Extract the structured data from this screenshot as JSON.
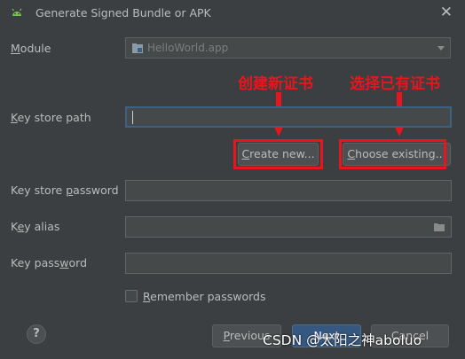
{
  "window": {
    "title": "Generate Signed Bundle or APK",
    "close_glyph": "✕"
  },
  "icons": {
    "app": "android-icon",
    "module": "module-folder-icon",
    "browse": "folder-icon",
    "help": "help-icon"
  },
  "module": {
    "label_u": "M",
    "label_rest": "odule",
    "value": "HelloWorld.app"
  },
  "keystore_path": {
    "label_u": "K",
    "label_rest": "ey store path",
    "value": ""
  },
  "buttons": {
    "create_new_u": "C",
    "create_new_rest": "reate new...",
    "choose_existing_u": "C",
    "choose_existing_rest": "hoose existing...",
    "previous_u": "P",
    "previous_rest": "revious",
    "next": "Next",
    "cancel": "Cancel",
    "help": "?"
  },
  "keystore_password": {
    "label_pre": "Key store ",
    "label_u": "p",
    "label_rest": "assword",
    "value": ""
  },
  "key_alias": {
    "label_pre": "K",
    "label_u": "e",
    "label_rest": "y alias",
    "value": ""
  },
  "key_password": {
    "label_pre": "Key pass",
    "label_u": "w",
    "label_rest": "ord",
    "value": ""
  },
  "remember": {
    "label_u": "R",
    "label_rest": "emember passwords",
    "checked": false
  },
  "annotations": {
    "create": "创建新证书",
    "choose": "选择已有证书"
  },
  "watermark": "CSDN @太阳之神aboluo",
  "colors": {
    "background": "#3c3f41",
    "accent": "#365880",
    "annotation": "#e8151c",
    "focus": "#3d6185"
  }
}
